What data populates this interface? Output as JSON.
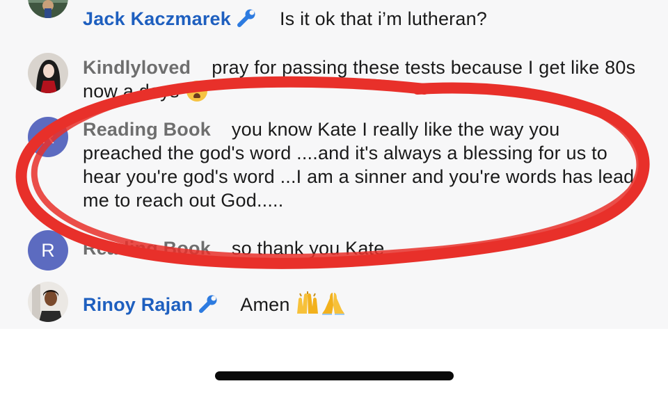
{
  "messages": [
    {
      "author": "Jack Kaczmarek",
      "is_moderator": true,
      "text": "Is it ok that i’m lutheran?",
      "avatar": "photo"
    },
    {
      "author": "Kindlyloved",
      "is_moderator": false,
      "text": "pray for passing these tests because I get like 80s now a days",
      "emoji": "crying-face-icon",
      "avatar": "photo"
    },
    {
      "author": "Reading Book",
      "is_moderator": false,
      "text": "you know Kate I really like the way you preached the god's word ....and it's always a blessing for us to hear you're god's word ...I am a sinner and you're words has lead me to reach out God.....",
      "avatar_letter": "R"
    },
    {
      "author": "Reading Book",
      "is_moderator": false,
      "text": "so thank you Kate",
      "avatar_letter": "R"
    },
    {
      "author": "Rinoy Rajan",
      "is_moderator": true,
      "text": "Amen",
      "emoji": "raised-hands-and-praying-hands-icons",
      "avatar": "photo"
    }
  ],
  "annotation": {
    "color": "#e8302a"
  },
  "colors": {
    "moderator_name": "#1e5fbf",
    "user_name": "#6e6e6e",
    "letter_avatar": "#5c6bc0"
  }
}
